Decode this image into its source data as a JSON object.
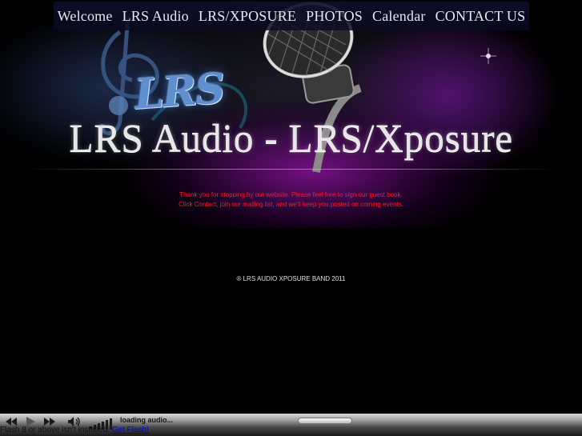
{
  "nav": {
    "items": [
      "Welcome",
      "LRS Audio",
      "LRS/XPOSURE",
      "PHOTOS",
      "Calendar",
      "CONTACT US"
    ]
  },
  "banner": {
    "logo_text": "LRS",
    "title": "LRS Audio - LRS/Xposure"
  },
  "content": {
    "welcome_line1": "Thank you for stopping by our website. Please feel free to sign our guest book.",
    "welcome_line2": "Click Contact, join our mailing list, and we'll keep you posted on coming events.",
    "copyright": "® LRS AUDIO XPOSURE BAND 2011"
  },
  "player": {
    "status": "loading audio...",
    "flash_message": "Flash 8 or above isn't installed.",
    "flash_link": "Get Flash!"
  },
  "icons": {
    "rewind": "rewind-icon",
    "play": "play-icon",
    "forward": "fast-forward-icon",
    "volume": "speaker-icon"
  },
  "colors": {
    "background": "#000000",
    "welcome_text": "#ff1a1a",
    "nav_text": "#e8e8f0",
    "link": "#0000cc"
  }
}
